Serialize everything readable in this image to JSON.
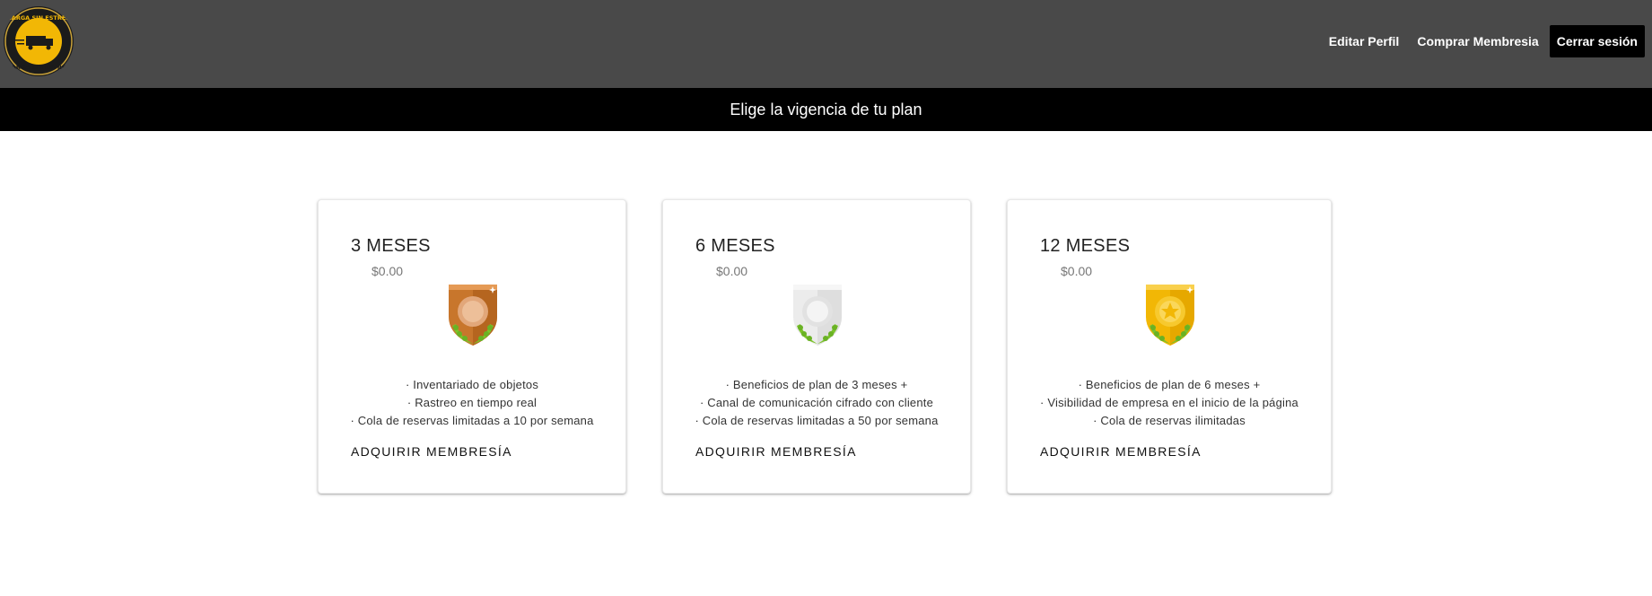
{
  "header": {
    "logo_text_top": "CARGA SIN ESTRES",
    "logo_text_bottom": "CARGA SIN ESTRES",
    "nav": {
      "edit_profile": "Editar Perfil",
      "buy_membership": "Comprar Membresia",
      "logout": "Cerrar sesión"
    }
  },
  "banner": {
    "title": "Elige la vigencia de tu plan"
  },
  "plans": [
    {
      "title": "3 MESES",
      "price": "$0.00",
      "badge": "bronze-badge-icon",
      "features": [
        "· Inventariado de objetos",
        "· Rastreo en tiempo real",
        "· Cola de reservas limitadas a 10 por semana"
      ],
      "cta": "ADQUIRIR MEMBRESÍA"
    },
    {
      "title": "6 MESES",
      "price": "$0.00",
      "badge": "silver-badge-icon",
      "features": [
        "· Beneficios de plan de 3 meses +",
        "· Canal de comunicación cifrado con cliente",
        "· Cola de reservas limitadas a 50 por semana"
      ],
      "cta": "ADQUIRIR MEMBRESÍA"
    },
    {
      "title": "12 MESES",
      "price": "$0.00",
      "badge": "gold-badge-icon",
      "features": [
        "· Beneficios de plan de 6 meses +",
        "· Visibilidad de empresa en el inicio de la página",
        "· Cola de reservas ilimitadas"
      ],
      "cta": "ADQUIRIR MEMBRESÍA"
    }
  ],
  "colors": {
    "header_bg": "#494949",
    "banner_bg": "#000000",
    "bronze": "#c8762c",
    "silver": "#e6e6e6",
    "gold": "#f2b705",
    "laurel": "#7cc42a"
  }
}
